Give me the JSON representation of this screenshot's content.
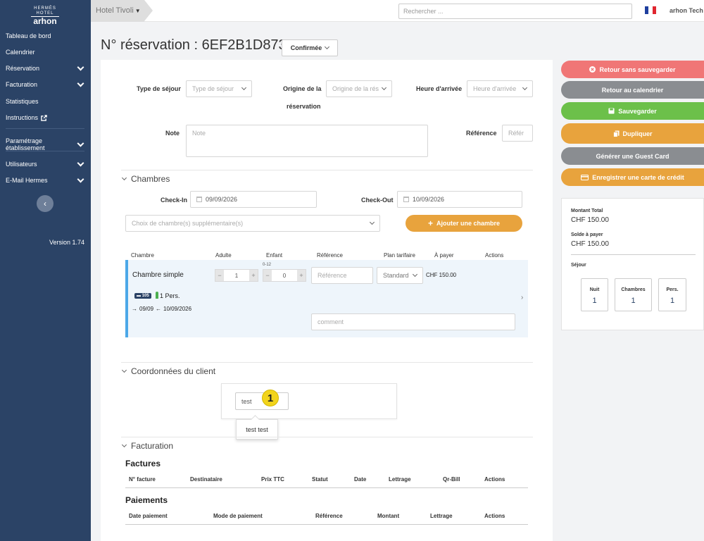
{
  "sidebar": {
    "logo_top": "HERMÈS HOTEL",
    "logo_text": "arhon",
    "items": [
      {
        "label": "Tableau de bord"
      },
      {
        "label": "Calendrier"
      },
      {
        "label": "Réservation"
      },
      {
        "label": "Facturation"
      },
      {
        "label": "Statistiques"
      },
      {
        "label": "Instructions"
      },
      {
        "label": "Paramétrage établissement"
      },
      {
        "label": "Utilisateurs"
      },
      {
        "label": "E-Mail Hermes"
      }
    ],
    "version": "Version 1.74"
  },
  "topbar": {
    "hotel": "Hotel Tivoli",
    "search_placeholder": "Rechercher ...",
    "user": "arhon Tech"
  },
  "header": {
    "title": "N° réservation : 6EF2B1D873 -",
    "status": "Confirmée"
  },
  "form": {
    "type_sejour_label": "Type de séjour",
    "type_sejour_placeholder": "Type de séjour",
    "origine_label_1": "Origine de la",
    "origine_label_2": "réservation",
    "origine_placeholder": "Origine de la rés",
    "heure_label": "Heure d'arrivée",
    "heure_placeholder": "Heure d'arrivée",
    "note_label": "Note",
    "note_placeholder": "Note",
    "reference_label": "Référence",
    "reference_placeholder": "Référ"
  },
  "chambres": {
    "title": "Chambres",
    "checkin_label": "Check-In",
    "checkin_value": "09/09/2026",
    "checkout_label": "Check-Out",
    "checkout_value": "10/09/2026",
    "extra_rooms_placeholder": "Choix de chambre(s) supplémentaire(s)",
    "add_room_button": "Ajouter une chambre",
    "columns": [
      "Chambre",
      "Adulte",
      "Enfant",
      "Référence",
      "Plan tarifaire",
      "À payer",
      "Actions"
    ],
    "room": {
      "name": "Chambre simple",
      "adults": "1",
      "child_age": "0-12",
      "children": "0",
      "reference_placeholder": "Référence",
      "rate_plan": "Standard",
      "amount": "CHF 150.00",
      "room_number": "105",
      "persons": "1 Pers.",
      "dates": "09/09",
      "dates_end": "10/09/2026",
      "comment_placeholder": "comment"
    }
  },
  "client": {
    "title": "Coordonnées du client",
    "input_value": "test",
    "annotation": "1",
    "suggestion": "test test"
  },
  "facturation": {
    "title": "Facturation",
    "factures_title": "Factures",
    "factures_columns": [
      "N° facture",
      "Destinataire",
      "Prix TTC",
      "Statut",
      "Date",
      "Lettrage",
      "Qr-Bill",
      "Actions"
    ],
    "paiements_title": "Paiements",
    "paiements_columns": [
      "Date paiement",
      "Mode de paiement",
      "Référence",
      "Montant",
      "Lettrage",
      "Actions"
    ]
  },
  "actions": {
    "back_no_save": "Retour sans sauvegarder",
    "back_calendar": "Retour au calendrier",
    "save": "Sauvegarder",
    "duplicate": "Dupliquer",
    "guest_card": "Générer une Guest Card",
    "credit_card": "Enregistrer une carte de crédit",
    "colors": {
      "red": "#f07676",
      "gray": "#8a8d91",
      "green": "#6cc04a",
      "orange": "#e8a33d"
    }
  },
  "summary": {
    "total_label": "Montant Total",
    "total_value": "CHF 150.00",
    "due_label": "Solde à payer",
    "due_value": "CHF 150.00",
    "sejour_label": "Séjour",
    "nights_label": "Nuit",
    "nights_value": "1",
    "rooms_label": "Chambres",
    "rooms_value": "1",
    "persons_label": "Pers.",
    "persons_value": "1"
  }
}
